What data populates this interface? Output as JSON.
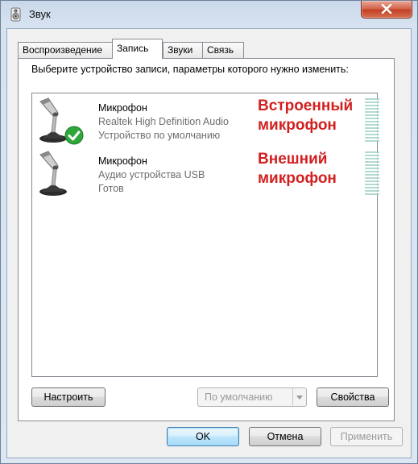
{
  "window": {
    "title": "Звук",
    "icon": "speaker-icon",
    "close_icon": "close-icon"
  },
  "tabs": [
    {
      "label": "Воспроизведение",
      "active": false
    },
    {
      "label": "Запись",
      "active": true
    },
    {
      "label": "Звуки",
      "active": false
    },
    {
      "label": "Связь",
      "active": false
    }
  ],
  "prompt": "Выберите устройство записи, параметры которого нужно изменить:",
  "devices": [
    {
      "name": "Микрофон",
      "description": "Realtek High Definition Audio",
      "status": "Устройство по умолчанию",
      "is_default": true,
      "icon": "microphone-icon",
      "annotation": [
        "Встроенный",
        "микрофон"
      ]
    },
    {
      "name": "Микрофон",
      "description": "Аудио устройства USB",
      "status": "Готов",
      "is_default": false,
      "icon": "microphone-icon",
      "annotation": [
        "Внешний",
        "микрофон"
      ]
    }
  ],
  "panel_buttons": {
    "configure": "Настроить",
    "set_default": "По умолчанию",
    "properties": "Свойства"
  },
  "dialog_buttons": {
    "ok": "OK",
    "cancel": "Отмена",
    "apply": "Применить"
  },
  "colors": {
    "annotation": "#d21f1f",
    "default_check": "#2fa63a"
  }
}
